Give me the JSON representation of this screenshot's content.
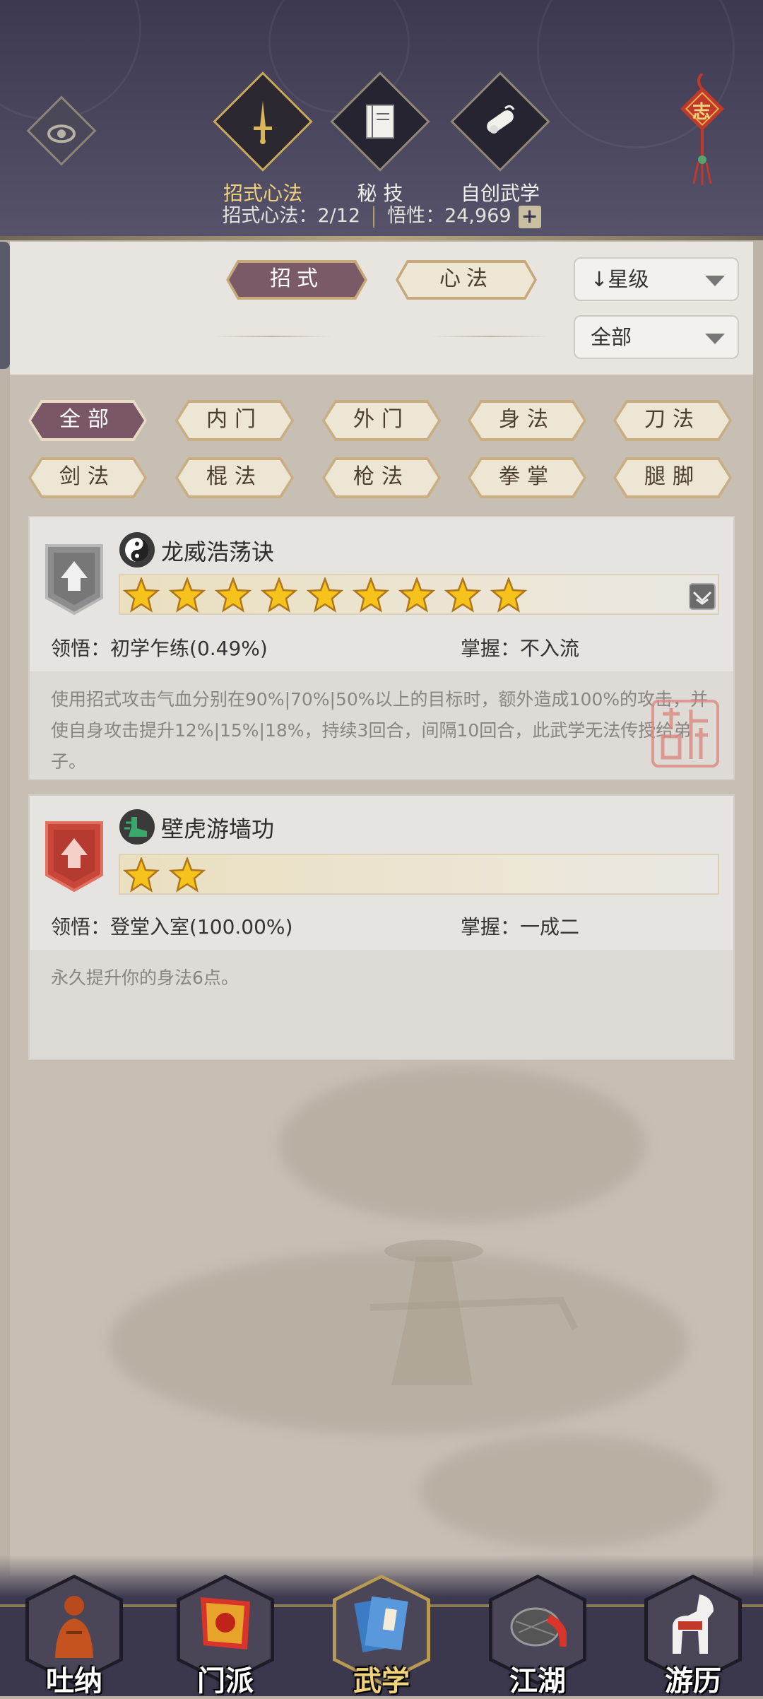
{
  "header": {
    "tabs": [
      {
        "label": "招式心法",
        "icon": "sword-icon",
        "active": true
      },
      {
        "label": "秘 技",
        "icon": "book-icon",
        "active": false
      },
      {
        "label": "自创武学",
        "icon": "scroll-icon",
        "active": false
      }
    ],
    "stats": {
      "moves_label": "招式心法：",
      "moves_value": "2/12",
      "insight_label": "悟性：",
      "insight_value": "24,969",
      "plus": "+"
    },
    "pendant_char": "志"
  },
  "filters": {
    "types": [
      {
        "label": "招式",
        "active": true
      },
      {
        "label": "心法",
        "active": false
      }
    ],
    "sort": {
      "label": "星级",
      "arrow": "↓"
    },
    "scope": {
      "label": "全部"
    }
  },
  "categories": [
    {
      "label": "全部",
      "active": true
    },
    {
      "label": "内门",
      "active": false
    },
    {
      "label": "外门",
      "active": false
    },
    {
      "label": "身法",
      "active": false
    },
    {
      "label": "刀法",
      "active": false
    },
    {
      "label": "剑法",
      "active": false
    },
    {
      "label": "棍法",
      "active": false
    },
    {
      "label": "枪法",
      "active": false
    },
    {
      "label": "拳掌",
      "active": false
    },
    {
      "label": "腿脚",
      "active": false
    }
  ],
  "skills": [
    {
      "name": "龙威浩荡诀",
      "type_icon": "yin-yang-icon",
      "rank_color": "#8d8d8d",
      "stars": 9,
      "comprehension_label": "领悟：",
      "comprehension_value": "初学乍练(0.49%)",
      "mastery_label": "掌握：",
      "mastery_value": "不入流",
      "description": "使用招式攻击气血分别在90%|70%|50%以上的目标时，额外造成100%的攻击，并使自身攻击提升12%|15%|18%，持续3回合，间隔10回合，此武学无法传授给弟子。"
    },
    {
      "name": "壁虎游墙功",
      "type_icon": "boot-icon",
      "rank_color": "#c9463a",
      "stars": 2,
      "comprehension_label": "领悟：",
      "comprehension_value": "登堂入室(100.00%)",
      "mastery_label": "掌握：",
      "mastery_value": "一成二",
      "description": "永久提升你的身法6点。"
    }
  ],
  "nav": [
    {
      "label": "吐纳",
      "icon": "monk-icon",
      "active": false
    },
    {
      "label": "门派",
      "icon": "banner-icon",
      "active": false
    },
    {
      "label": "武学",
      "icon": "manual-icon",
      "active": true
    },
    {
      "label": "江湖",
      "icon": "hat-icon",
      "active": false
    },
    {
      "label": "游历",
      "icon": "horse-icon",
      "active": false
    }
  ]
}
